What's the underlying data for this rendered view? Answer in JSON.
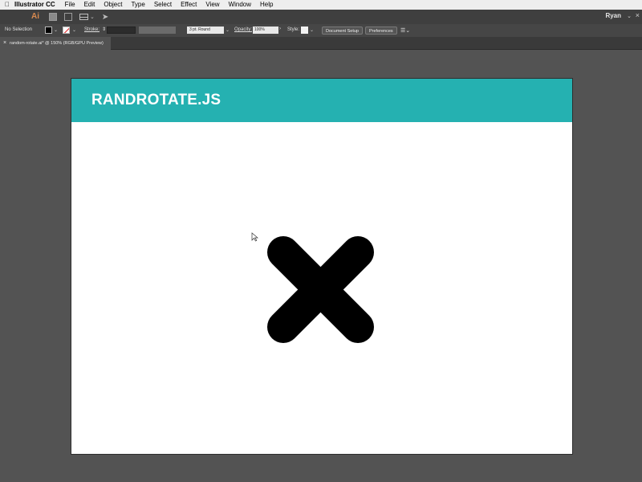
{
  "menubar": {
    "app_name": "Illustrator CC",
    "items": [
      "File",
      "Edit",
      "Object",
      "Type",
      "Select",
      "Effect",
      "View",
      "Window",
      "Help"
    ]
  },
  "appbar": {
    "logo": "Ai",
    "user": "Ryan"
  },
  "controlbar": {
    "selection": "No Selection",
    "stroke_label": "Stroke:",
    "brush": "3 pt. Round",
    "opacity_label": "Opacity:",
    "opacity_value": "100%",
    "style_label": "Style:",
    "document_setup": "Document Setup",
    "preferences": "Preferences"
  },
  "tab": {
    "title": "random-rotate.ai* @ 150% (RGB/GPU Preview)"
  },
  "artboard": {
    "title": "RANDROTATE.JS",
    "banner_color": "#25b1b1"
  },
  "icons": [
    "apple-icon",
    "cc-libraries-icon",
    "bridge-icon",
    "workspace-icon",
    "rocket-icon",
    "arrange-icon",
    "close-icon",
    "cursor-icon"
  ]
}
